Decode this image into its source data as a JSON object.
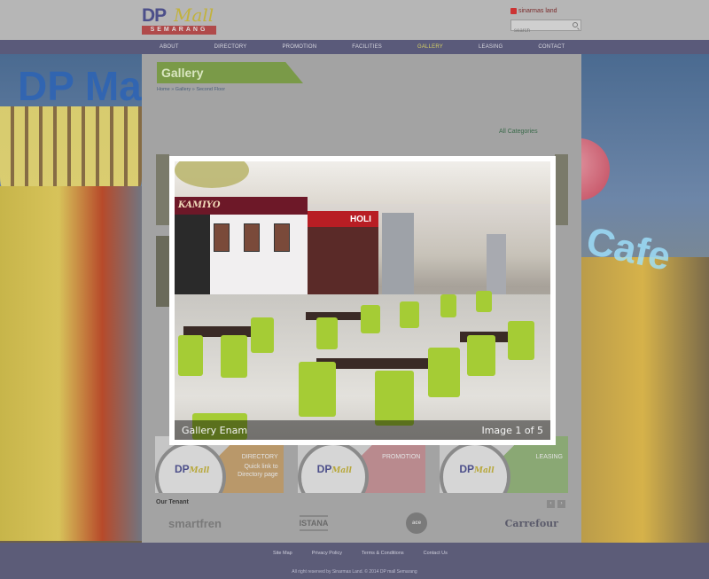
{
  "header": {
    "logo_dp": "DP",
    "logo_mall": "Mall",
    "logo_city": "SEMARANG",
    "brand": "sinarmas land",
    "search_placeholder": "search"
  },
  "nav": {
    "items": [
      "ABOUT US",
      "DIRECTORY",
      "PROMOTION & EVENT",
      "FACILITIES",
      "GALLERY",
      "LEASING",
      "CONTACT US"
    ]
  },
  "page": {
    "title": "Gallery",
    "breadcrumb": "Home » Gallery » Second Floor",
    "all_categories": "All Categories"
  },
  "lightbox": {
    "caption": "Gallery Enam",
    "counter": "Image 1 of 5",
    "photo_signs": {
      "left": "KAMIYO",
      "middle": "HOLI"
    }
  },
  "cards": [
    {
      "label": "DIRECTORY",
      "sub": "Quick link to Directory page",
      "logo_dp": "DP",
      "logo_mall": "Mall"
    },
    {
      "label": "PROMOTION",
      "sub": "",
      "logo_dp": "DP",
      "logo_mall": "Mall"
    },
    {
      "label": "LEASING",
      "sub": "",
      "logo_dp": "DP",
      "logo_mall": "Mall"
    }
  ],
  "tenants": {
    "title": "Our Tenant",
    "prev": "‹",
    "next": "›",
    "items": [
      "smartfren",
      "ISTANA",
      "ace",
      "Carrefour"
    ]
  },
  "footer": {
    "links": [
      "Site Map",
      "Privacy Policy",
      "Terms & Conditions",
      "Contact Us"
    ],
    "copyright": "All right reserved by Sinarmas Land. © 2014 DP mall Semarang"
  },
  "colors": {
    "nav_bg": "#5a5a7a",
    "accent_green": "#7a9a48",
    "active_nav": "#d5d065",
    "footer_bg": "#5c5c78"
  }
}
